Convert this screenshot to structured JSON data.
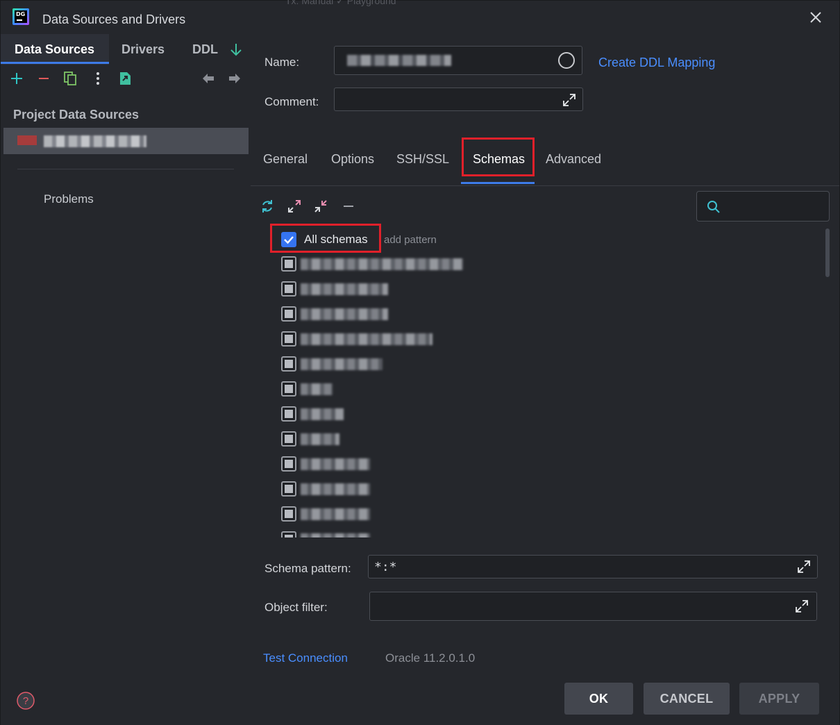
{
  "window": {
    "title": "Data Sources and Drivers",
    "logo_text": "DG",
    "ghost_toolbar": "Tx: Manual  ✓   Playground"
  },
  "left": {
    "tabs": [
      {
        "label": "Data Sources",
        "active": true
      },
      {
        "label": "Drivers",
        "active": false
      },
      {
        "label": "DDL",
        "active": false
      }
    ],
    "toolbar_icons": [
      "add-icon",
      "remove-icon",
      "duplicate-icon",
      "more-icon",
      "import-icon",
      "back-icon",
      "forward-icon"
    ],
    "section_title": "Project Data Sources",
    "data_source": {
      "name": "",
      "color": "#a63c3c"
    },
    "problems_label": "Problems"
  },
  "form": {
    "name_label": "Name:",
    "name_value": "",
    "create_ddl_label": "Create DDL Mapping",
    "comment_label": "Comment:",
    "comment_value": ""
  },
  "tabs": [
    {
      "label": "General",
      "active": false
    },
    {
      "label": "Options",
      "active": false
    },
    {
      "label": "SSH/SSL",
      "active": false
    },
    {
      "label": "Schemas",
      "active": true
    },
    {
      "label": "Advanced",
      "active": false
    }
  ],
  "schemas": {
    "all_schemas_label": "All schemas",
    "add_pattern_label": "add pattern",
    "all_checked": true,
    "items": [
      {
        "name": ""
      },
      {
        "name": ""
      },
      {
        "name": ""
      },
      {
        "name": ""
      },
      {
        "name": ""
      },
      {
        "name": ""
      },
      {
        "name": ""
      },
      {
        "name": ""
      },
      {
        "name": ""
      },
      {
        "name": ""
      },
      {
        "name": ""
      },
      {
        "name": ""
      }
    ],
    "search_placeholder": ""
  },
  "filters": {
    "schema_pattern_label": "Schema pattern:",
    "schema_pattern_value": "*:*",
    "object_filter_label": "Object filter:",
    "object_filter_value": ""
  },
  "footer": {
    "test_connection_label": "Test Connection",
    "driver_version": "Oracle 11.2.0.1.0",
    "ok_label": "OK",
    "cancel_label": "CANCEL",
    "apply_label": "APPLY"
  },
  "colors": {
    "accent": "#3574f0",
    "link": "#4a8eff",
    "highlight": "#e0202a",
    "background": "#25272c"
  }
}
